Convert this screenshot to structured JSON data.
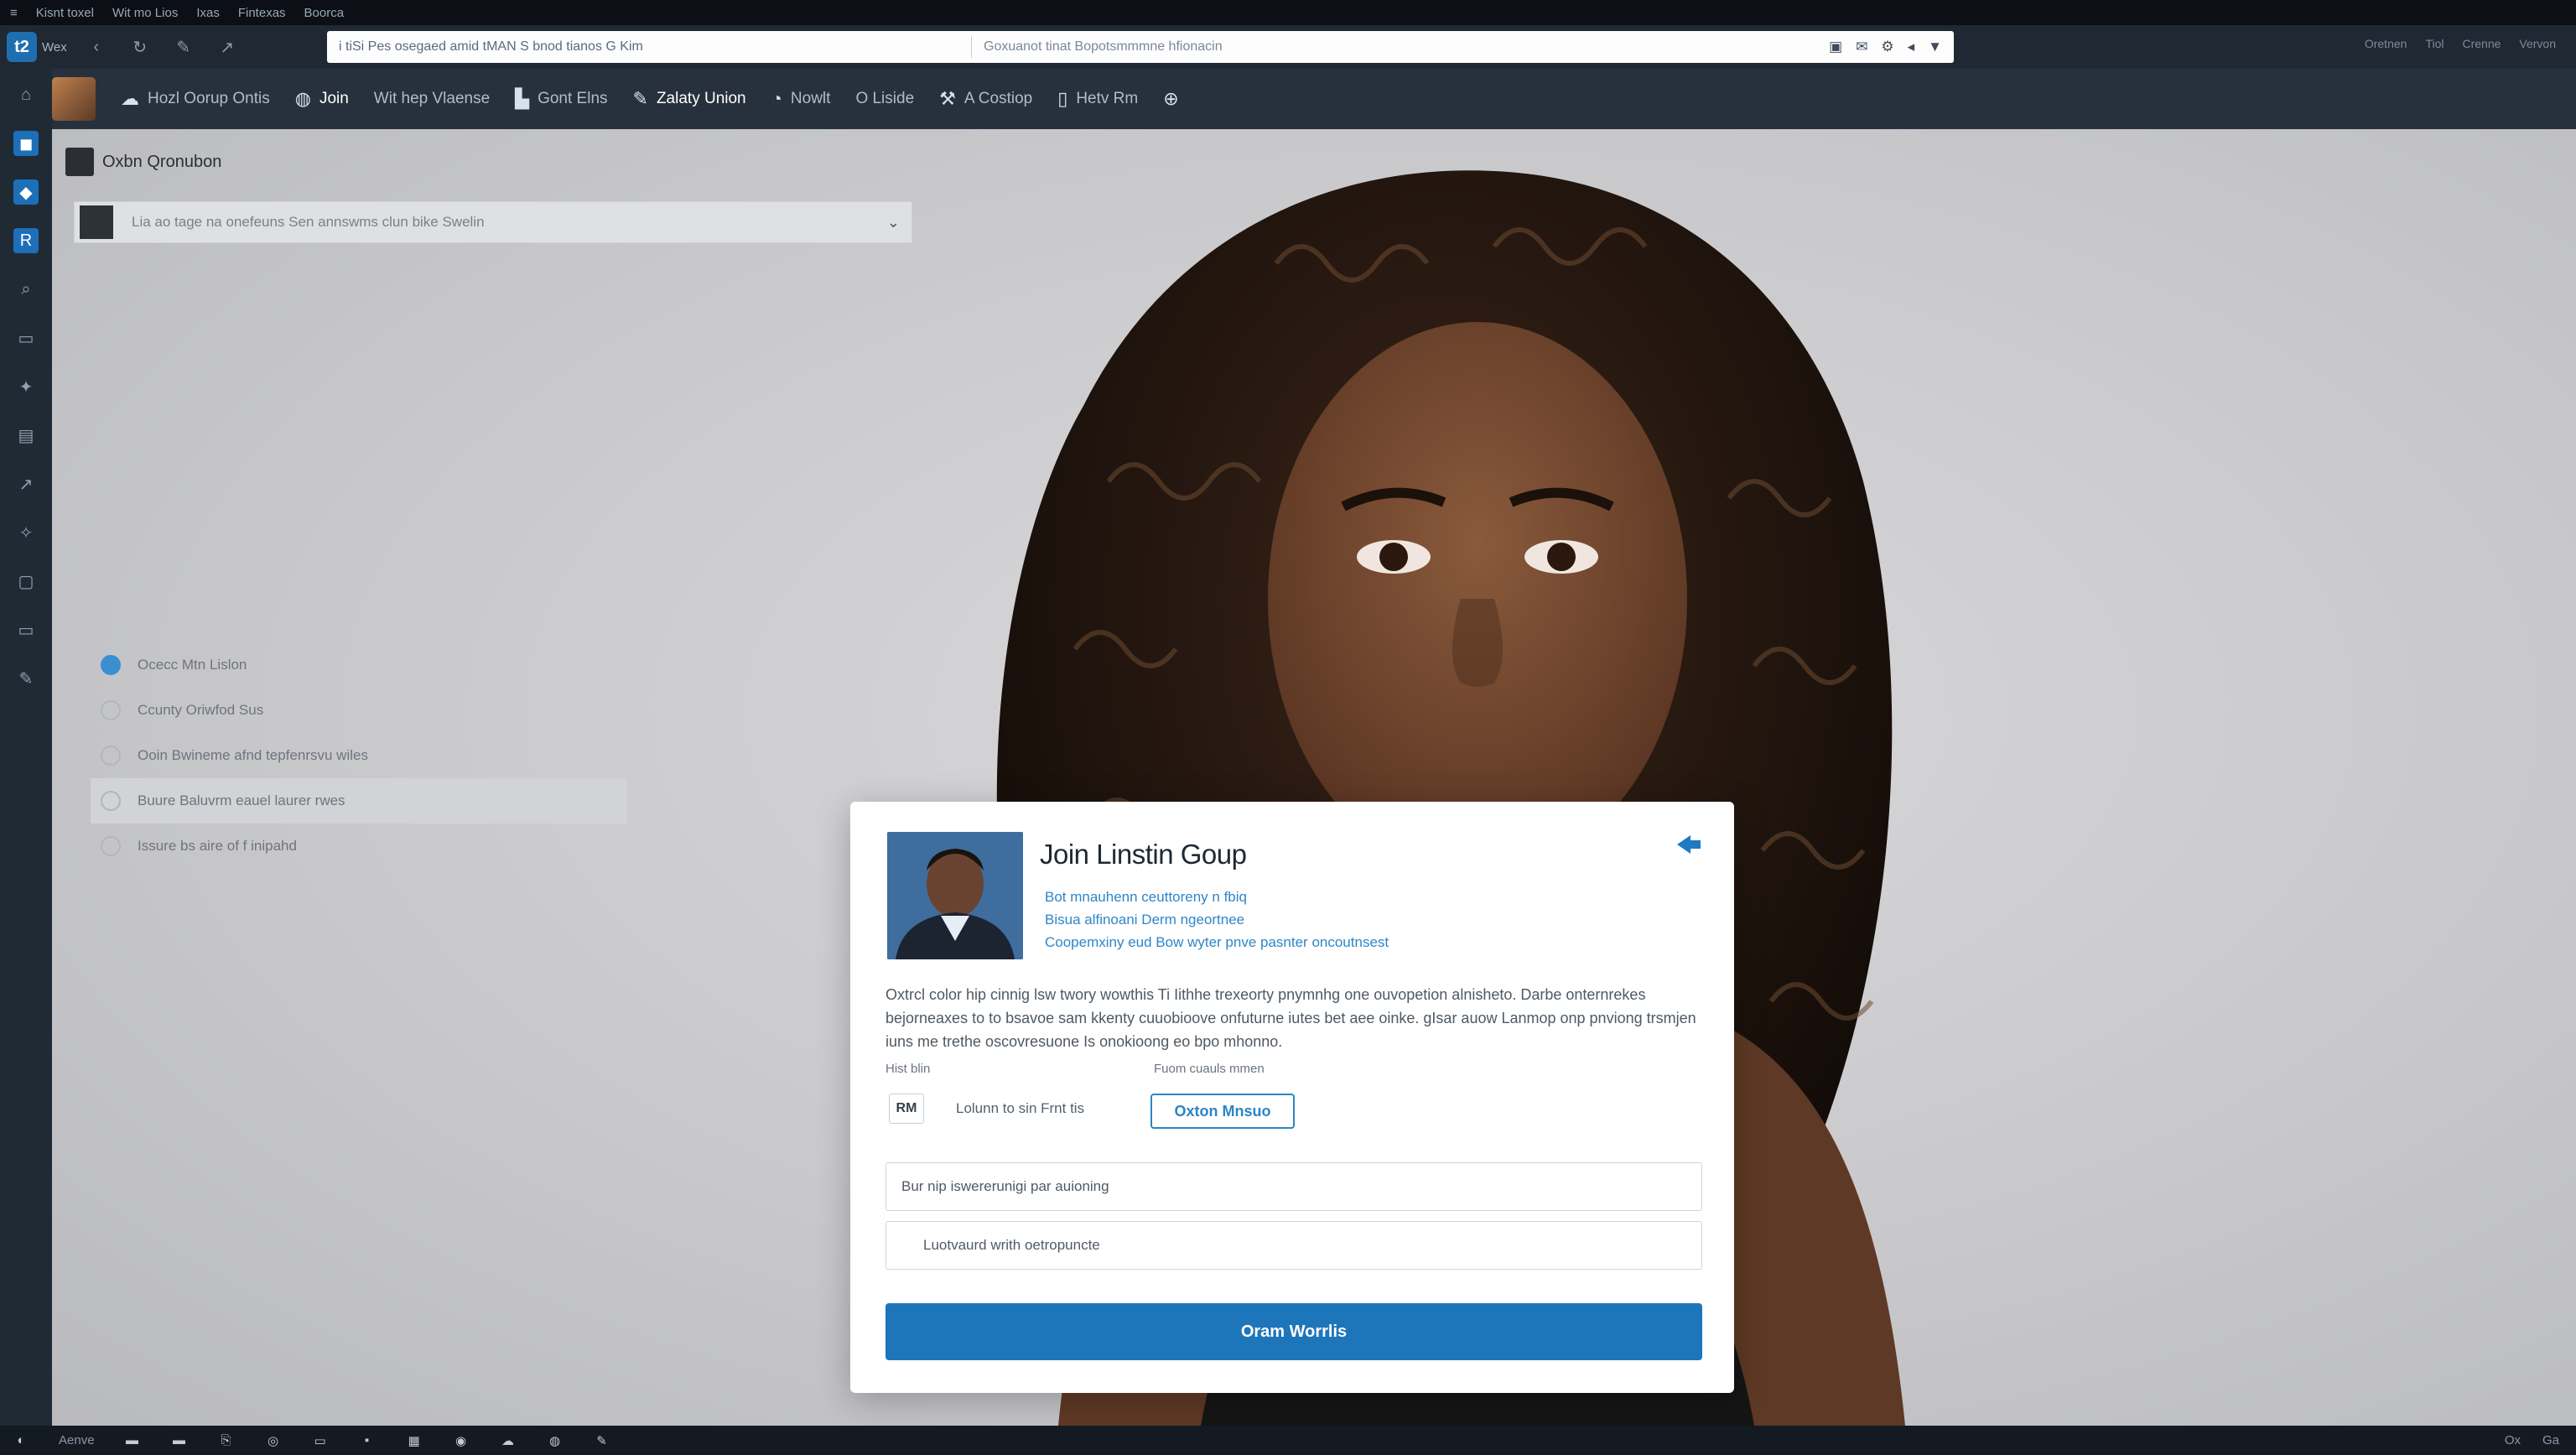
{
  "topbar": {
    "items": [
      "Kisnt toxel",
      "Wit mo Lios",
      "Ixas",
      "Fintexas",
      "Boorca"
    ]
  },
  "browser": {
    "nav_label": "Wex",
    "url": "i tiSi Pes osegaed amid tMAN S bnod tianos G Kim",
    "search_hint": "Goxuanot tinat Bopotsmmmne hfionacin",
    "right_items": [
      "Oretnen",
      "Tiol",
      "Crenne",
      "Vervon"
    ]
  },
  "appnav": {
    "items": [
      {
        "icon": "cloud-icon",
        "label": "Hozl Oorup Ontis"
      },
      {
        "icon": "globe-icon",
        "label": "Join"
      },
      {
        "icon": "",
        "label": "Wit hep Vlaense"
      },
      {
        "icon": "building-icon",
        "label": "Gont Elns"
      },
      {
        "icon": "pencil-icon",
        "label": "Zalaty Union"
      },
      {
        "icon": "drop-icon",
        "label": "Nowlt"
      },
      {
        "icon": "",
        "label": "O Liside"
      },
      {
        "icon": "tools-icon",
        "label": "A Costiop"
      },
      {
        "icon": "doc-icon",
        "label": "Hetv Rm"
      },
      {
        "icon": "link-icon",
        "label": ""
      }
    ]
  },
  "sidepanel": {
    "title": "Oxbn Qronubon",
    "select_text": "Lia ao tage na onefeuns Sen annswms clun bike Swelin",
    "items": [
      {
        "label": "Ocecc Mtn Lislon",
        "state": "active"
      },
      {
        "label": "Ccunty Oriwfod Sus",
        "state": ""
      },
      {
        "label": "Ooin Bwineme afnd tepfenrsvu wiles",
        "state": ""
      },
      {
        "label": "Buure Baluvrm eauel laurer rwes",
        "state": "selected"
      },
      {
        "label": "Issure bs aire of f inipahd",
        "state": ""
      }
    ]
  },
  "modal": {
    "title": "Join Linstin Goup",
    "subtitle_lines": [
      "Bot mnauhenn ceuttoreny n fbiq",
      "Bisua alfinoani  Derm ngeortnee",
      "Coopemxiny eud Bow wyter pnve pasnter oncoutnsest"
    ],
    "body": "Oxtrcl color hip cinnig lsw twory wowthis Ti Iithhe trexeorty pnymnhg one ouvopetion alnisheto. Darbe onternrekes bejorneaxes to to bsavoe sam kkenty cuuobioove onfuturne iutes bet aee oinke. gIsar auow Lanmop onp pnviong trsmjen iuns me trethe oscovresuone Is onokioong eo bpo mhonno.",
    "label_left": "Hist blin",
    "label_right": "Fuom cuauls mmen",
    "chip_code": "RM",
    "chip_text": "Lolunn to sin Frnt tis",
    "outline_button": "Oxton Mnsuo",
    "field1_value": "Bur nip iswererunigi par auioning",
    "field2_value": "Luotvaurd writh oetropuncte",
    "primary_button": "Oram Worrlis"
  },
  "taskbar": {
    "items": [
      "Aenve"
    ],
    "right": [
      "Ox",
      "Ga"
    ]
  },
  "colors": {
    "accent": "#1e76ba",
    "link": "#2e86c8",
    "chrome_dark": "#202a35"
  }
}
